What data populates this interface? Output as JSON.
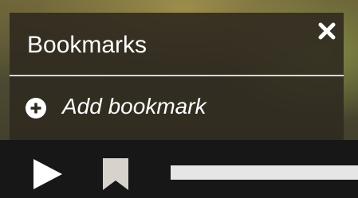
{
  "bookmarks_panel": {
    "title": "Bookmarks",
    "close_icon": "close-icon",
    "add_bookmark": {
      "icon": "plus-circle-icon",
      "label": "Add bookmark"
    }
  },
  "controls": {
    "play_icon": "play-icon",
    "bookmark_icon": "bookmark-icon"
  },
  "colors": {
    "panel_bg": "#302a20",
    "text": "#ffffff",
    "control_bar": "#171717",
    "progress_track": "#e6e6e6"
  }
}
